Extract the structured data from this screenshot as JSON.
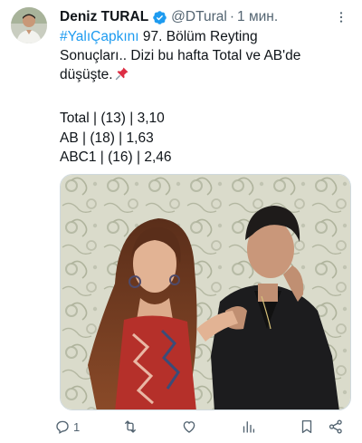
{
  "author": {
    "name": "Deniz TURAL",
    "handle": "@DTural",
    "separator": "·",
    "time": "1 мин."
  },
  "tweet": {
    "hashtag": "#YalıÇapkını",
    "line1_rest": " 97. Bölüm Reyting",
    "line2": "Sonuçları.. Dizi bu hafta Total ve AB'de",
    "line3": "düşüşte.",
    "ratings": [
      "Total | (13) | 3,10",
      "AB | (18) | 1,63",
      "ABC1 | (16) | 2,46"
    ]
  },
  "actions": {
    "reply_count": "1",
    "reply_icon": "reply-icon",
    "retweet_icon": "retweet-icon",
    "like_icon": "heart-icon",
    "views_icon": "views-icon",
    "bookmark_icon": "bookmark-icon",
    "share_icon": "share-icon"
  },
  "colors": {
    "link": "#1d9bf0",
    "verified": "#1d9bf0",
    "secondary_text": "#536471",
    "primary_text": "#0f1419"
  }
}
